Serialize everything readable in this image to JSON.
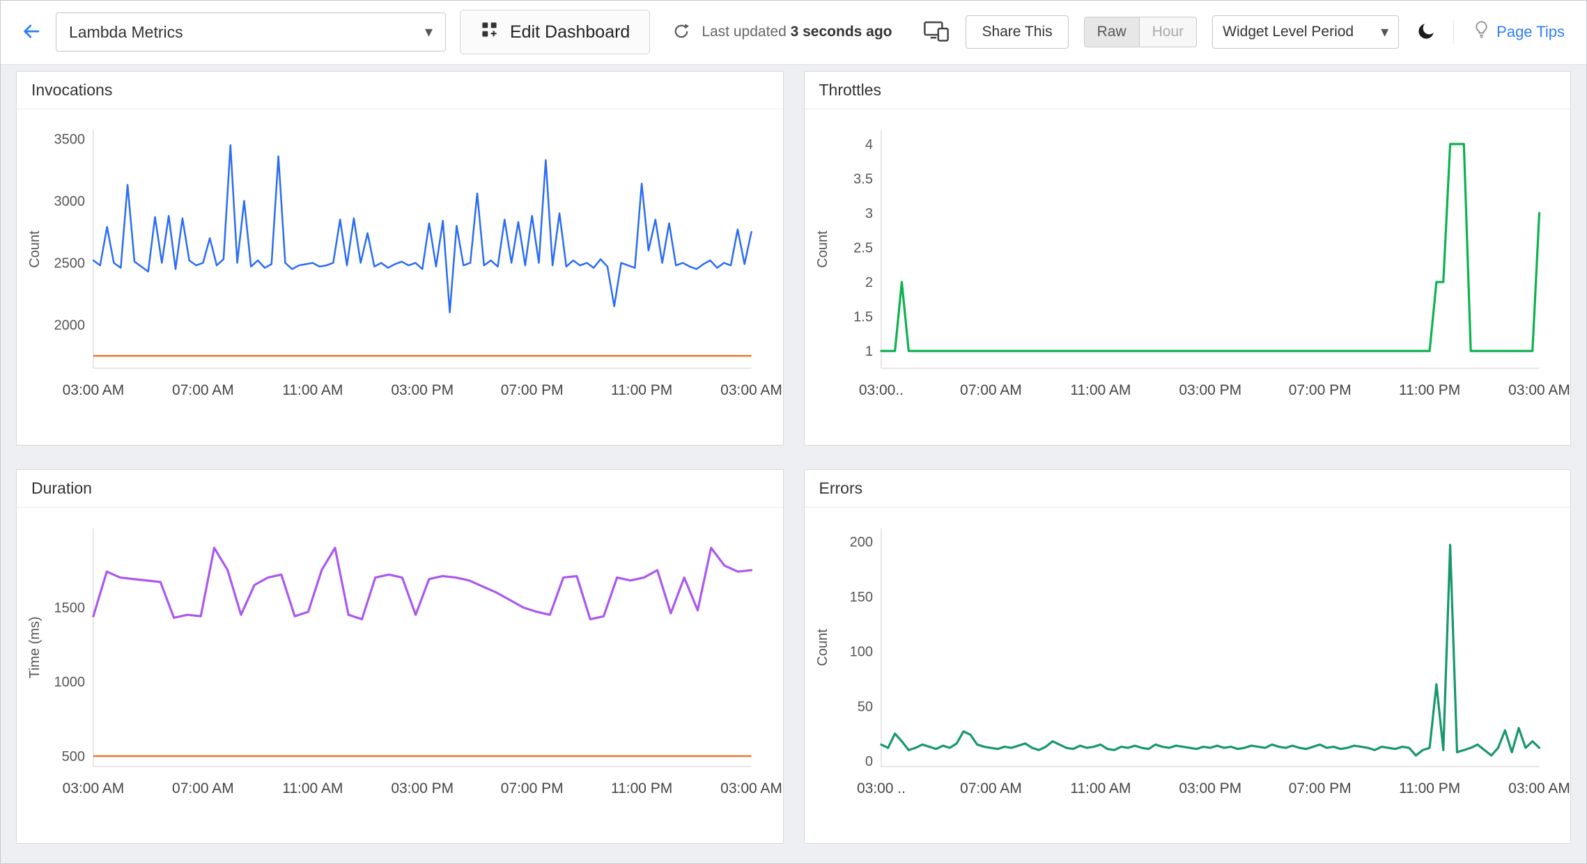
{
  "header": {
    "dashboard_selector_value": "Lambda Metrics",
    "edit_dashboard_label": "Edit Dashboard",
    "last_updated_prefix": "Last updated",
    "last_updated_value": "3 seconds ago",
    "share_this_label": "Share This",
    "period_toggle": {
      "raw": "Raw",
      "hour": "Hour"
    },
    "widget_period_label": "Widget Level Period",
    "page_tips_label": "Page Tips",
    "icons": {
      "back": "arrow-left-icon",
      "edit": "dashboard-grid-icon",
      "refresh": "refresh-icon",
      "devices": "devices-icon",
      "dark_mode": "moon-icon",
      "tips": "lightbulb-icon",
      "dropdown": "chevron-down-icon"
    }
  },
  "colors": {
    "accent_blue": "#2d7ff9",
    "invocations_line": "#2a6cf5",
    "throttles_line": "#0db14e",
    "duration_line": "#ab57f0",
    "errors_line": "#17976c",
    "threshold_orange": "#e8772e",
    "page_background": "#edeff3"
  },
  "chart_data": [
    {
      "type": "line",
      "title": "Invocations",
      "ylabel": "Count",
      "grid": false,
      "legend": false,
      "line_width": 2.5,
      "ylim": [
        1650,
        3570
      ],
      "yticks": [
        2000,
        2500,
        3000,
        3500
      ],
      "x_tick_labels": [
        "03:00 AM",
        "07:00 AM",
        "11:00 AM",
        "03:00 PM",
        "07:00 PM",
        "11:00 PM",
        "03:00 AM"
      ],
      "threshold": {
        "value": 1750,
        "color": "#e8772e"
      },
      "series": [
        {
          "name": "Invocations",
          "color": "#2a6cf5",
          "values": [
            2520,
            2480,
            2790,
            2500,
            2460,
            3130,
            2510,
            2470,
            2430,
            2870,
            2500,
            2880,
            2450,
            2860,
            2520,
            2480,
            2500,
            2700,
            2480,
            2530,
            3450,
            2500,
            3000,
            2470,
            2520,
            2460,
            2490,
            3360,
            2500,
            2450,
            2480,
            2490,
            2500,
            2470,
            2480,
            2500,
            2850,
            2480,
            2860,
            2500,
            2740,
            2470,
            2500,
            2460,
            2490,
            2510,
            2480,
            2500,
            2450,
            2820,
            2470,
            2840,
            2100,
            2800,
            2480,
            2500,
            3060,
            2480,
            2520,
            2470,
            2850,
            2500,
            2830,
            2480,
            2880,
            2500,
            3330,
            2480,
            2900,
            2470,
            2520,
            2480,
            2500,
            2460,
            2530,
            2470,
            2150,
            2500,
            2480,
            2460,
            3140,
            2600,
            2850,
            2500,
            2820,
            2480,
            2500,
            2470,
            2450,
            2490,
            2520,
            2460,
            2500,
            2480,
            2770,
            2490,
            2750
          ]
        }
      ]
    },
    {
      "type": "line",
      "title": "Throttles",
      "ylabel": "Count",
      "grid": false,
      "legend": false,
      "line_width": 3.2,
      "ylim": [
        0.75,
        4.2
      ],
      "yticks": [
        1,
        1.5,
        2,
        2.5,
        3,
        3.5,
        4
      ],
      "x_tick_labels": [
        "03:00..",
        "07:00 AM",
        "11:00 AM",
        "03:00 PM",
        "07:00 PM",
        "11:00 PM",
        "03:00 AM"
      ],
      "series": [
        {
          "name": "Throttles",
          "color": "#0db14e",
          "values": [
            1,
            1,
            1,
            2,
            1,
            1,
            1,
            1,
            1,
            1,
            1,
            1,
            1,
            1,
            1,
            1,
            1,
            1,
            1,
            1,
            1,
            1,
            1,
            1,
            1,
            1,
            1,
            1,
            1,
            1,
            1,
            1,
            1,
            1,
            1,
            1,
            1,
            1,
            1,
            1,
            1,
            1,
            1,
            1,
            1,
            1,
            1,
            1,
            1,
            1,
            1,
            1,
            1,
            1,
            1,
            1,
            1,
            1,
            1,
            1,
            1,
            1,
            1,
            1,
            1,
            1,
            1,
            1,
            1,
            1,
            1,
            1,
            1,
            1,
            1,
            1,
            1,
            1,
            1,
            1,
            1,
            2,
            2,
            4,
            4,
            4,
            1,
            1,
            1,
            1,
            1,
            1,
            1,
            1,
            1,
            1,
            3
          ]
        }
      ]
    },
    {
      "type": "line",
      "title": "Duration",
      "ylabel": "Time (ms)",
      "grid": false,
      "legend": false,
      "line_width": 3.2,
      "ylim": [
        430,
        2030
      ],
      "yticks": [
        500,
        1000,
        1500
      ],
      "x_tick_labels": [
        "03:00 AM",
        "07:00 AM",
        "11:00 AM",
        "03:00 PM",
        "07:00 PM",
        "11:00 PM",
        "03:00 AM"
      ],
      "threshold": {
        "value": 500,
        "color": "#e8772e"
      },
      "series": [
        {
          "name": "Duration",
          "color": "#ab57f0",
          "values": [
            1440,
            1740,
            1700,
            1690,
            1680,
            1670,
            1430,
            1450,
            1440,
            1900,
            1750,
            1450,
            1650,
            1700,
            1720,
            1440,
            1470,
            1750,
            1900,
            1450,
            1420,
            1700,
            1720,
            1700,
            1450,
            1690,
            1710,
            1700,
            1680,
            1640,
            1600,
            1550,
            1500,
            1470,
            1450,
            1700,
            1710,
            1420,
            1440,
            1700,
            1680,
            1700,
            1750,
            1460,
            1700,
            1480,
            1900,
            1780,
            1740,
            1750
          ]
        }
      ]
    },
    {
      "type": "line",
      "title": "Errors",
      "ylabel": "Count",
      "grid": false,
      "legend": false,
      "line_width": 3.2,
      "ylim": [
        -5,
        212
      ],
      "yticks": [
        0,
        50,
        100,
        150,
        200
      ],
      "x_tick_labels": [
        "03:00 ..",
        "07:00 AM",
        "11:00 AM",
        "03:00 PM",
        "07:00 PM",
        "11:00 PM",
        "03:00 AM"
      ],
      "series": [
        {
          "name": "Errors",
          "color": "#17976c",
          "values": [
            15,
            12,
            25,
            18,
            10,
            12,
            15,
            13,
            11,
            14,
            12,
            16,
            27,
            24,
            15,
            13,
            12,
            11,
            13,
            12,
            14,
            16,
            12,
            10,
            13,
            18,
            15,
            12,
            11,
            14,
            12,
            13,
            15,
            11,
            10,
            13,
            12,
            14,
            12,
            11,
            15,
            13,
            12,
            14,
            13,
            12,
            11,
            13,
            12,
            14,
            12,
            13,
            11,
            12,
            14,
            13,
            12,
            15,
            13,
            12,
            14,
            12,
            11,
            13,
            15,
            12,
            13,
            11,
            12,
            14,
            13,
            12,
            10,
            13,
            12,
            11,
            13,
            12,
            5,
            10,
            12,
            70,
            10,
            197,
            8,
            10,
            12,
            15,
            10,
            5,
            12,
            28,
            8,
            30,
            12,
            18,
            12
          ]
        }
      ]
    }
  ]
}
